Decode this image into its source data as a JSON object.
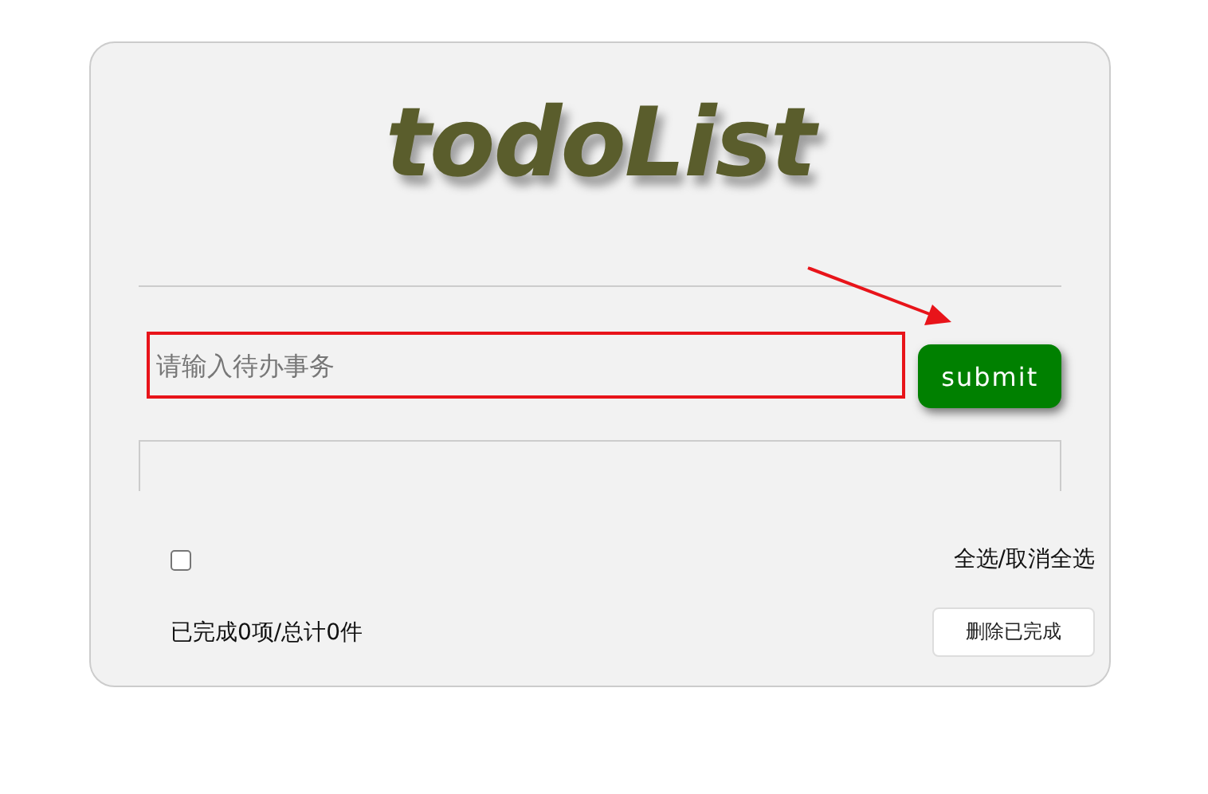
{
  "title": "todoList",
  "input": {
    "placeholder": "请输入待办事务",
    "highlighted": true
  },
  "submit_button": "submit",
  "select_all": {
    "checked": false,
    "label": "全选/取消全选"
  },
  "summary": "已完成0项/总计0件",
  "delete_button": "删除已完成"
}
